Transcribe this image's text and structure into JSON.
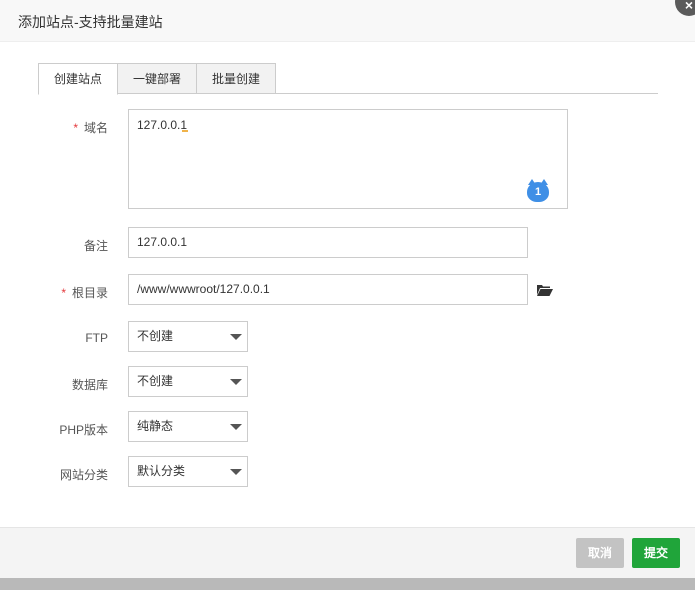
{
  "dialog": {
    "title": "添加站点-支持批量建站",
    "close_icon": "close-icon"
  },
  "tabs": [
    {
      "label": "创建站点",
      "active": true
    },
    {
      "label": "一键部署",
      "active": false
    },
    {
      "label": "批量创建",
      "active": false
    }
  ],
  "form": {
    "required_mark": "*",
    "domain": {
      "label": "域名",
      "value": "127.0.0.1",
      "line_badge": "1"
    },
    "remark": {
      "label": "备注",
      "value": "127.0.0.1"
    },
    "root": {
      "label": "根目录",
      "value": "/www/wwwroot/127.0.0.1",
      "icon": "folder-open-icon"
    },
    "ftp": {
      "label": "FTP",
      "selected": "不创建"
    },
    "database": {
      "label": "数据库",
      "selected": "不创建"
    },
    "php": {
      "label": "PHP版本",
      "selected": "纯静态"
    },
    "category": {
      "label": "网站分类",
      "selected": "默认分类"
    }
  },
  "footer": {
    "cancel_label": "取消",
    "submit_label": "提交"
  },
  "colors": {
    "submit": "#20a53a",
    "cancel": "#c3c3c3",
    "required": "#e4393c",
    "badge": "#3f8fe6"
  }
}
